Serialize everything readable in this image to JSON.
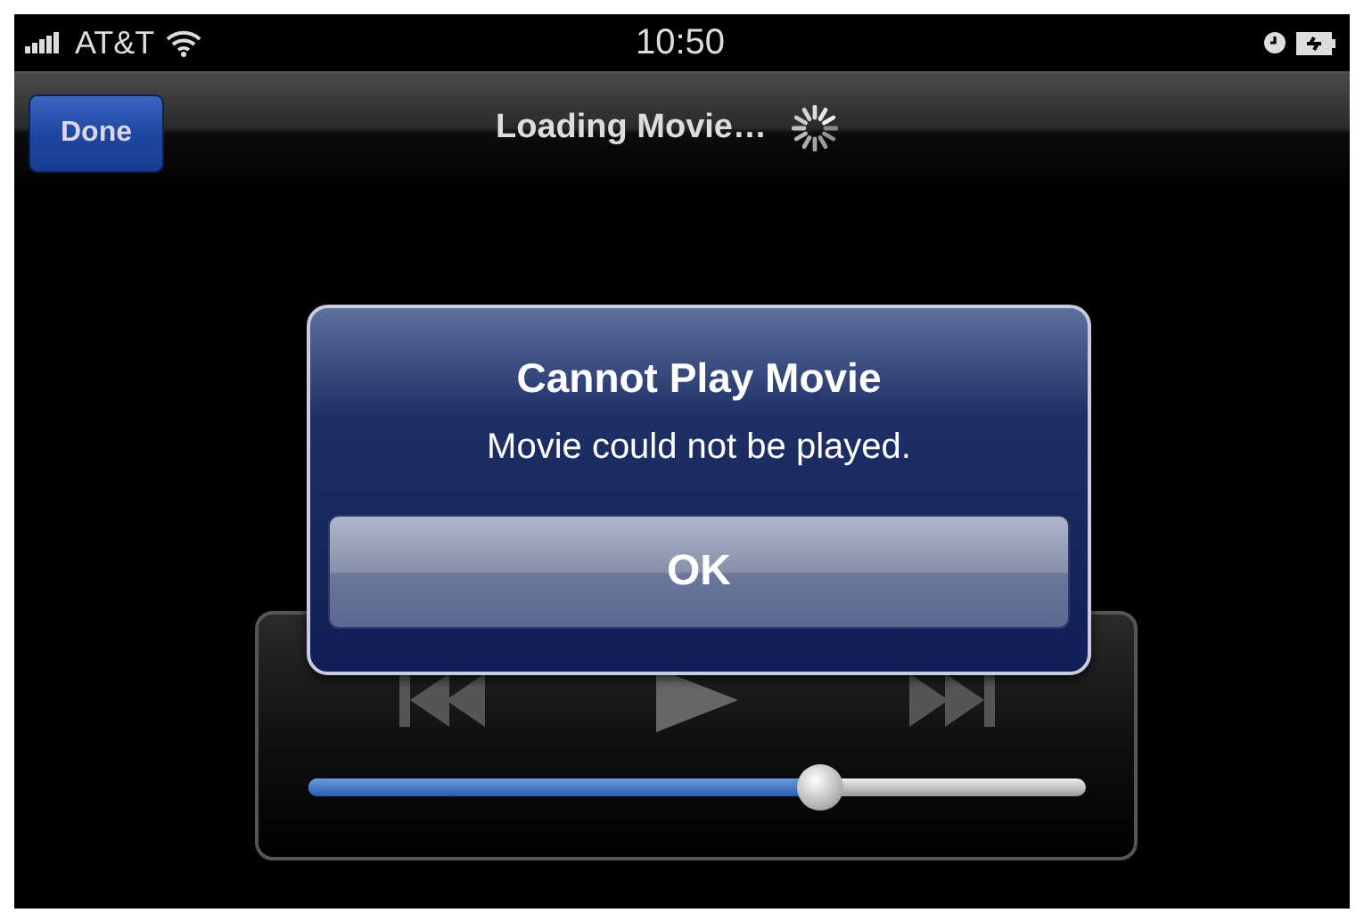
{
  "status_bar": {
    "carrier": "AT&T",
    "time": "10:50"
  },
  "nav_bar": {
    "button": "Done",
    "title": "Loading Movie…"
  },
  "alert": {
    "title": "Cannot Play Movie",
    "message": "Movie could not be played.",
    "button": "OK"
  },
  "volume": {
    "level": 0.66
  }
}
